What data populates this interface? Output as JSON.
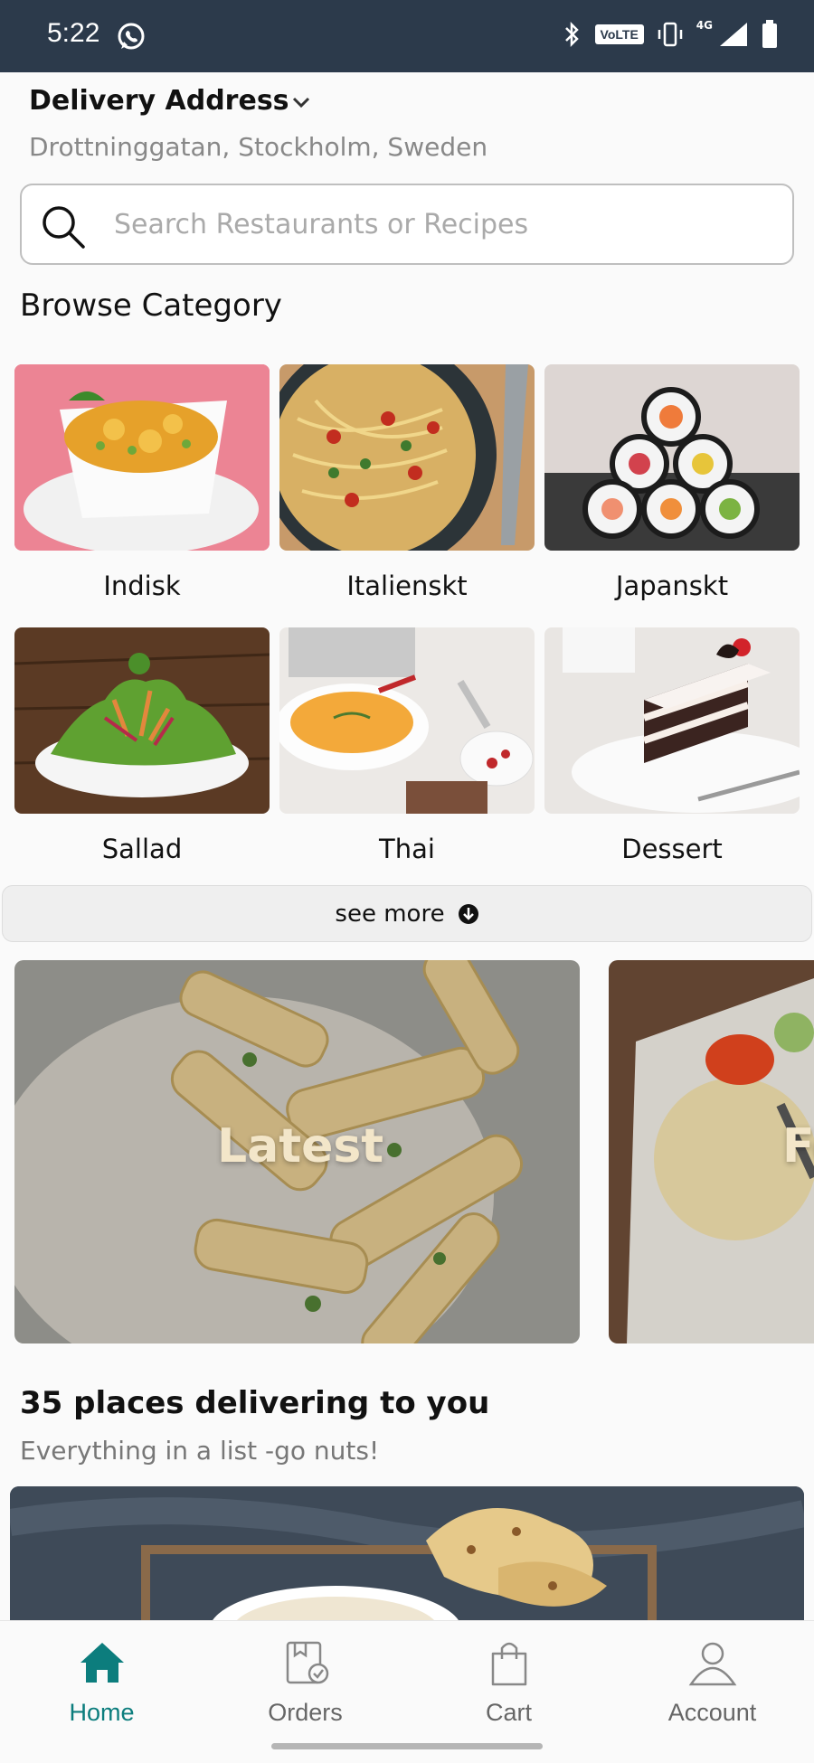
{
  "status_bar": {
    "time": "5:22",
    "volte": "VoLTE",
    "network": "4G"
  },
  "address": {
    "title": "Delivery Address",
    "value": "Drottninggatan, Stockholm, Sweden"
  },
  "search": {
    "placeholder": "Search Restaurants or Recipes",
    "value": ""
  },
  "browse": {
    "title": "Browse Category",
    "categories": [
      {
        "label": "Indisk"
      },
      {
        "label": "Italienskt"
      },
      {
        "label": "Japanskt"
      },
      {
        "label": "Sallad"
      },
      {
        "label": "Thai"
      },
      {
        "label": "Dessert"
      }
    ],
    "see_more": "see more"
  },
  "carousel": [
    {
      "label": "Latest"
    },
    {
      "label": "Fe"
    }
  ],
  "places": {
    "title": "35 places delivering to you",
    "subtitle": "Everything in a list -go nuts!"
  },
  "nav": {
    "items": [
      {
        "label": "Home",
        "icon": "home-icon",
        "active": true
      },
      {
        "label": "Orders",
        "icon": "orders-icon",
        "active": false
      },
      {
        "label": "Cart",
        "icon": "cart-icon",
        "active": false
      },
      {
        "label": "Account",
        "icon": "account-icon",
        "active": false
      }
    ]
  },
  "colors": {
    "status_bar": "#2c3a4b",
    "accent": "#0c7d7d",
    "background": "#fafafa"
  }
}
